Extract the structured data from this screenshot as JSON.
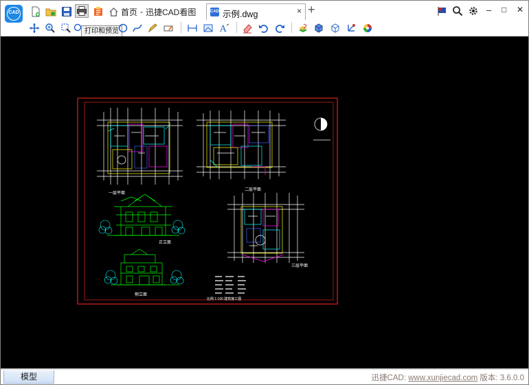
{
  "tabs": {
    "home_label": "首页",
    "app_title": "迅捷CAD看图",
    "separator": "-",
    "document_name": "示例.dwg",
    "close_glyph": "×",
    "new_tab_glyph": "+",
    "dwg_icon_text": "CAD"
  },
  "app": {
    "logo_text": "CAD"
  },
  "tooltip": {
    "text": "打印和预览"
  },
  "window_controls": {
    "minimize": "–",
    "maximize": "□",
    "close": "✕"
  },
  "bottom": {
    "model_tab": "模型",
    "status_prefix": "迅捷CAD:",
    "website": "www.xunjiecad.com",
    "version_label": "版本:",
    "version": "3.6.0.0"
  },
  "drawing": {
    "label_plan1": "一层平面",
    "label_plan2": "二层平面",
    "label_plan3": "三层平面",
    "label_elev1": "正立面",
    "label_elev2": "侧立面",
    "bottom_note": "比例 1:100 建筑施工图"
  },
  "colors": {
    "canvas": "#000000",
    "frame": "#cc2020",
    "plan_white": "#ffffff",
    "plan_yellow": "#ffff00",
    "plan_cyan": "#00ffff",
    "plan_magenta": "#ff00ff",
    "plan_blue": "#4060ff",
    "elevation_green": "#00ff00",
    "status_text": "#8a7a72"
  }
}
